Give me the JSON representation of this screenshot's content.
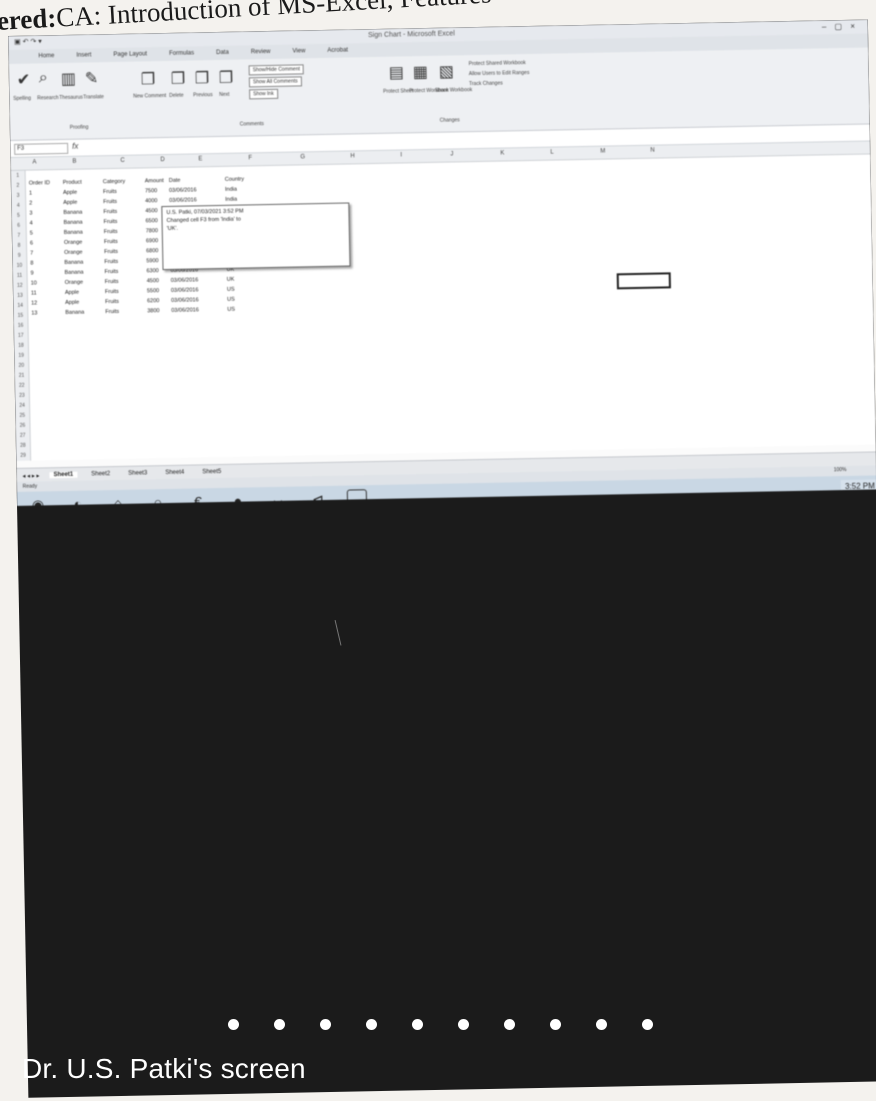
{
  "page_heading": {
    "prefix": "ered:",
    "text": "CA: Introduction of MS-Excel, Features"
  },
  "excel": {
    "window_title": "Sign Chart - Microsoft Excel",
    "window_controls": "– ▢ ×",
    "qat": "▣ ↶ ↷ ▾",
    "ribbon_tabs": [
      "Home",
      "Insert",
      "Page Layout",
      "Formulas",
      "Data",
      "Review",
      "View",
      "Acrobat"
    ],
    "ribbon": {
      "labels": [
        "Spelling",
        "Research",
        "Thesaurus",
        "Translate",
        "New Comment",
        "Delete",
        "Previous",
        "Next",
        "Show/Hide Comment",
        "Show All Comments",
        "Show Ink",
        "Protect Sheet",
        "Protect Workbook",
        "Share Workbook"
      ],
      "right_items": [
        "Protect Shared Workbook",
        "Allow Users to Edit Ranges",
        "Track Changes"
      ],
      "group_names": [
        "Proofing",
        "Comments",
        "Changes"
      ]
    },
    "namebox": "F3",
    "col_headers": [
      "A",
      "B",
      "C",
      "D",
      "E",
      "F",
      "G",
      "H",
      "I",
      "J",
      "K",
      "L",
      "M",
      "N"
    ],
    "rows": [
      [
        "Order ID",
        "Product",
        "Category",
        "Amount",
        "Date",
        "Country"
      ],
      [
        "1",
        "Apple",
        "Fruits",
        "7500",
        "03/06/2016",
        "India"
      ],
      [
        "2",
        "Apple",
        "Fruits",
        "4000",
        "03/06/2016",
        "India"
      ],
      [
        "3",
        "Banana",
        "Fruits",
        "4500",
        "03/06/2016",
        "India"
      ],
      [
        "4",
        "Banana",
        "Fruits",
        "6500",
        "03/06/2016",
        "India"
      ],
      [
        "5",
        "Banana",
        "Fruits",
        "7800",
        "03/06/2016",
        "India"
      ],
      [
        "6",
        "Orange",
        "Fruits",
        "6900",
        "03/06/2016",
        "India"
      ],
      [
        "7",
        "Orange",
        "Fruits",
        "6800",
        "03/06/2016",
        "UK"
      ],
      [
        "8",
        "Banana",
        "Fruits",
        "5900",
        "03/06/2016",
        "UK"
      ],
      [
        "9",
        "Banana",
        "Fruits",
        "6300",
        "03/06/2016",
        "UK"
      ],
      [
        "10",
        "Orange",
        "Fruits",
        "4500",
        "03/06/2016",
        "UK"
      ],
      [
        "11",
        "Apple",
        "Fruits",
        "5500",
        "03/06/2016",
        "US"
      ],
      [
        "12",
        "Apple",
        "Fruits",
        "6200",
        "03/06/2016",
        "US"
      ],
      [
        "13",
        "Banana",
        "Fruits",
        "3800",
        "03/06/2016",
        "US"
      ]
    ],
    "comment": {
      "line1": "U.S. Patki, 07/03/2021 3:52 PM",
      "line2": "Changed cell F3 from 'India' to",
      "line3": "'UK'."
    },
    "sheet_tabs": [
      "Sheet1",
      "Sheet2",
      "Sheet3",
      "Sheet4",
      "Sheet5"
    ],
    "status": "Ready",
    "zoom": "100%",
    "tray_time": "3:52 PM"
  },
  "share_overlay": {
    "presenter_label": "Dr. U.S. Patki's screen",
    "page_dots": 10
  }
}
